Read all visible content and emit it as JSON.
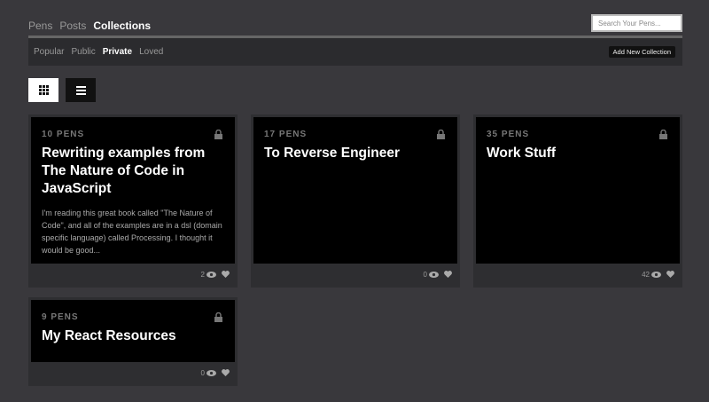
{
  "nav": {
    "tabs": [
      {
        "label": "Pens"
      },
      {
        "label": "Posts"
      },
      {
        "label": "Collections"
      }
    ]
  },
  "search": {
    "placeholder": "Search Your Pens..."
  },
  "subnav": {
    "tabs": [
      {
        "label": "Popular"
      },
      {
        "label": "Public"
      },
      {
        "label": "Private"
      },
      {
        "label": "Loved"
      }
    ],
    "add_button": "Add New Collection"
  },
  "collections": [
    {
      "count": "10 PENS",
      "title": "Rewriting examples from The Nature of Code in JavaScript",
      "description": "I'm reading this great book called \"The Nature of Code\", and all of the examples are in a dsl (domain specific language) called Processing. I thought it would be good...",
      "views": "2"
    },
    {
      "count": "17 PENS",
      "title": "To Reverse Engineer",
      "description": "",
      "views": "0"
    },
    {
      "count": "35 PENS",
      "title": "Work Stuff",
      "description": "",
      "views": "42"
    },
    {
      "count": "9 PENS",
      "title": "My React Resources",
      "description": "",
      "views": "0"
    }
  ],
  "icons": {
    "lock": "lock-icon",
    "eye": "eye-icon",
    "heart": "heart-icon",
    "grid": "grid-view-icon",
    "list": "list-view-icon"
  }
}
